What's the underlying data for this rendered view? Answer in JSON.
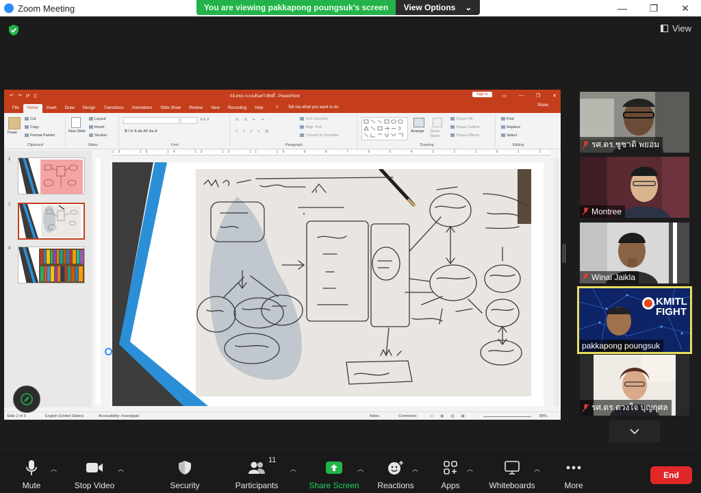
{
  "window": {
    "title": "Zoom Meeting",
    "controls": [
      "—",
      "❐",
      "✕"
    ]
  },
  "banner": {
    "text": "You are viewing pakkapong poungsuk's screen",
    "options_label": "View Options"
  },
  "view_label": "View",
  "powerpoint": {
    "doc_title": "03-สรุป-ระบบค้นคว้าสิทธิ์  -  PowerPoint",
    "signin": "Sign in",
    "tabs": [
      "File",
      "Home",
      "Insert",
      "Draw",
      "Design",
      "Transitions",
      "Animations",
      "Slide Show",
      "Review",
      "View",
      "Recording",
      "Help",
      "Tell me what you want to do"
    ],
    "share": "Share",
    "ribbon": {
      "clipboard": {
        "paste": "Paste",
        "cut": "Cut",
        "copy": "Copy",
        "format_painter": "Format Painter",
        "label": "Clipboard"
      },
      "slides": {
        "new_slide": "New Slide",
        "layout": "Layout",
        "reset": "Reset",
        "section": "Section",
        "label": "Slides"
      },
      "font": {
        "label": "Font",
        "buttons": "B  I  U  S  ab  AV  Aa  A"
      },
      "paragraph": {
        "text_direction": "Text Direction",
        "align_text": "Align Text",
        "smartart": "Convert to SmartArt",
        "label": "Paragraph"
      },
      "drawing": {
        "arrange": "Arrange",
        "quick_styles": "Quick Styles",
        "shape_fill": "Shape Fill",
        "shape_outline": "Shape Outline",
        "shape_effects": "Shape Effects",
        "label": "Drawing"
      },
      "editing": {
        "find": "Find",
        "replace": "Replace",
        "select": "Select",
        "label": "Editing"
      }
    },
    "ruler_text": "16 · 15 · 14 · 13 · 12 · 11 · 10 · 9 · 8 · 7 · 6 · 5 · 4 · 3 · 2 · 1 · 0 · 1 · 2 · 3 · 4 · 5 · 6 · 7 · 8 · 9 · 10 · 11 · 12 · 13 · 14 · 15 · 16",
    "slide_numbers": [
      "1",
      "2",
      "3"
    ],
    "selected_slide": 2,
    "status": {
      "slide": "Slide 2 of 3",
      "language": "English (United States)",
      "accessibility": "Accessibility: Investigate",
      "notes": "Notes",
      "comments": "Comments",
      "zoom": "89%"
    }
  },
  "participants_tiles": [
    {
      "name": "รศ.ดร.ชูชาติ  พยอม",
      "muted": true
    },
    {
      "name": "Montree",
      "muted": true
    },
    {
      "name": "Winai Jaikla",
      "muted": true
    },
    {
      "name": "pakkapong poungsuk",
      "muted": false,
      "active_speaker": true,
      "bg_text": "KMITL FIGHT"
    },
    {
      "name": "รศ.ดร.ดวงใจ บุญกุศล",
      "muted": true
    }
  ],
  "toolbar": {
    "mute": "Mute",
    "stop_video": "Stop Video",
    "security": "Security",
    "participants": "Participants",
    "participants_count": "11",
    "share_screen": "Share Screen",
    "reactions": "Reactions",
    "apps": "Apps",
    "whiteboards": "Whiteboards",
    "more": "More",
    "end": "End"
  },
  "colors": {
    "zoom_green": "#23b34a",
    "ppt_red": "#c43e1c",
    "end_red": "#e02828",
    "active_outline": "#e9e05a",
    "zoom_blue": "#2d8cff"
  }
}
